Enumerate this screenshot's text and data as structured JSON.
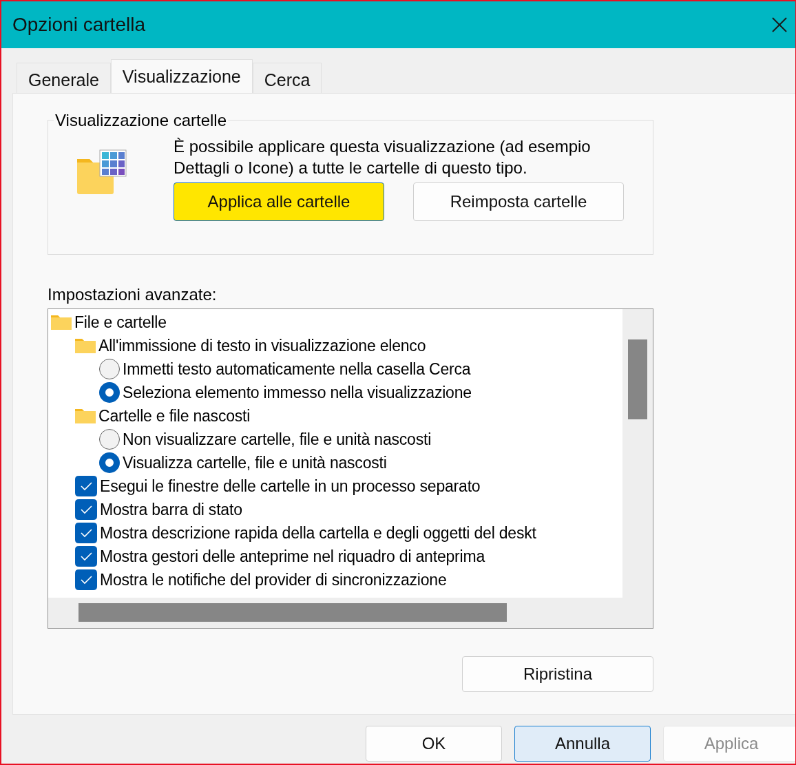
{
  "window": {
    "title": "Opzioni cartella"
  },
  "tabs": [
    {
      "label": "Generale",
      "selected": false
    },
    {
      "label": "Visualizzazione",
      "selected": true
    },
    {
      "label": "Cerca",
      "selected": false
    }
  ],
  "folder_views": {
    "title": "Visualizzazione cartelle",
    "description": "È possibile applicare questa visualizzazione (ad esempio Dettagli o Icone) a tutte le cartelle di questo tipo.",
    "buttons": [
      {
        "label": "Applica alle cartelle",
        "highlighted": true
      },
      {
        "label": "Reimposta cartelle",
        "highlighted": false
      }
    ]
  },
  "advanced": {
    "label": "Impostazioni avanzate:",
    "tree": [
      {
        "kind": "folder",
        "label": "File e cartelle",
        "children": [
          {
            "kind": "folder",
            "label": "All'immissione di testo in visualizzazione elenco",
            "children": [
              {
                "kind": "radio",
                "label": "Immetti testo automaticamente nella casella Cerca",
                "selected": false
              },
              {
                "kind": "radio",
                "label": "Seleziona elemento immesso nella visualizzazione",
                "selected": true
              }
            ]
          },
          {
            "kind": "folder",
            "label": "Cartelle e file nascosti",
            "children": [
              {
                "kind": "radio",
                "label": "Non visualizzare cartelle, file e unità nascosti",
                "selected": false
              },
              {
                "kind": "radio",
                "label": "Visualizza cartelle, file e unità nascosti",
                "selected": true
              }
            ]
          },
          {
            "kind": "checkbox",
            "label": "Esegui le finestre delle cartelle in un processo separato",
            "checked": true
          },
          {
            "kind": "checkbox",
            "label": "Mostra barra di stato",
            "checked": true
          },
          {
            "kind": "checkbox",
            "label": "Mostra descrizione rapida della cartella e degli oggetti del deskt",
            "checked": true
          },
          {
            "kind": "checkbox",
            "label": "Mostra gestori delle anteprime nel riquadro di anteprima",
            "checked": true
          },
          {
            "kind": "checkbox",
            "label": "Mostra le notifiche del provider di sincronizzazione",
            "checked": true
          }
        ]
      }
    ]
  },
  "restore_button": "Ripristina",
  "footer_buttons": [
    {
      "label": "OK",
      "kind": "normal"
    },
    {
      "label": "Annulla",
      "kind": "default"
    },
    {
      "label": "Applica",
      "kind": "disabled"
    }
  ]
}
